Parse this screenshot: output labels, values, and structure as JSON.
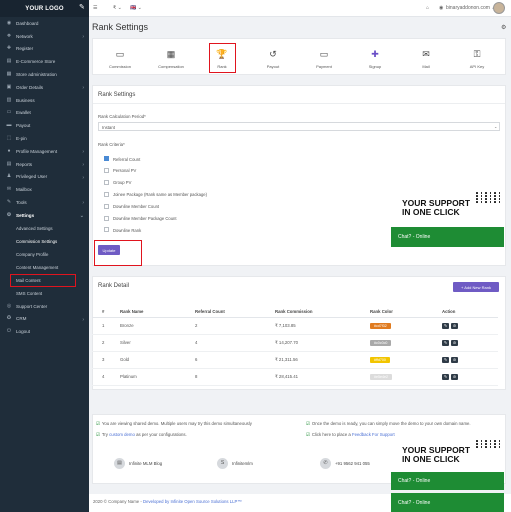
{
  "sidebar": {
    "logo": "YOUR LOGO",
    "items": [
      {
        "label": "Dashboard",
        "icon": "dashboard-icon",
        "glyph": "◉",
        "chev": ""
      },
      {
        "label": "Network",
        "icon": "network-icon",
        "glyph": "❖",
        "chev": "›"
      },
      {
        "label": "Register",
        "icon": "register-icon",
        "glyph": "✚",
        "chev": ""
      },
      {
        "label": "E-Commerce Store",
        "icon": "store-icon",
        "glyph": "▤",
        "chev": ""
      },
      {
        "label": "Store administration",
        "icon": "store-admin-icon",
        "glyph": "▦",
        "chev": ""
      },
      {
        "label": "Order Details",
        "icon": "order-icon",
        "glyph": "▣",
        "chev": "›"
      },
      {
        "label": "Business",
        "icon": "business-icon",
        "glyph": "▥",
        "chev": ""
      },
      {
        "label": "Ewallet",
        "icon": "wallet-icon",
        "glyph": "▭",
        "chev": ""
      },
      {
        "label": "Payout",
        "icon": "payout-icon",
        "glyph": "▬",
        "chev": ""
      },
      {
        "label": "E-pin",
        "icon": "pin-icon",
        "glyph": "⬚",
        "chev": ""
      },
      {
        "label": "Profile Management",
        "icon": "profile-icon",
        "glyph": "●",
        "chev": "›"
      },
      {
        "label": "Reports",
        "icon": "reports-icon",
        "glyph": "▤",
        "chev": "›"
      },
      {
        "label": "Privileged User",
        "icon": "privileged-user-icon",
        "glyph": "♟",
        "chev": "›"
      },
      {
        "label": "Mailbox",
        "icon": "mailbox-icon",
        "glyph": "✉",
        "chev": ""
      },
      {
        "label": "Tools",
        "icon": "tools-icon",
        "glyph": "✎",
        "chev": "›"
      },
      {
        "label": "Settings",
        "icon": "settings-icon",
        "glyph": "⚙",
        "chev": "⌄"
      }
    ],
    "sub_items": [
      "Advanced Settings",
      "Commission Settings",
      "Company Profile",
      "Content Management",
      "Mail Content",
      "SMS Content"
    ],
    "bottom_items": [
      {
        "label": "Support Center",
        "icon": "support-icon",
        "glyph": "◎",
        "chev": ""
      },
      {
        "label": "CRM",
        "icon": "crm-icon",
        "glyph": "✪",
        "chev": "›"
      },
      {
        "label": "Logout",
        "icon": "logout-icon",
        "glyph": "⏻",
        "chev": ""
      }
    ]
  },
  "topbar": {
    "menu": "☰",
    "currency": "₹ ⌄",
    "flag": "🇬🇧 ⌄",
    "cart": "⌂",
    "bell": "◉",
    "user": "binaryaddonon.com ⌄"
  },
  "page": {
    "title": "Rank Settings"
  },
  "tabs": [
    {
      "label": "Commission",
      "glyph": "▭",
      "purple": false
    },
    {
      "label": "Compensation",
      "glyph": "▦",
      "purple": false
    },
    {
      "label": "Rank",
      "glyph": "🏆",
      "purple": false
    },
    {
      "label": "Payout",
      "glyph": "↺",
      "purple": false
    },
    {
      "label": "Payment",
      "glyph": "▭",
      "purple": false
    },
    {
      "label": "Signup",
      "glyph": "✚",
      "purple": true
    },
    {
      "label": "Mail",
      "glyph": "✉",
      "purple": false
    },
    {
      "label": "API Key",
      "glyph": "⚿",
      "purple": false
    }
  ],
  "rank_settings": {
    "title": "Rank Settings",
    "period_label": "Rank Calculation Period*",
    "period_value": "Instant",
    "criteria_label": "Rank Criteria*",
    "criteria": [
      {
        "label": "Referral Count",
        "checked": true
      },
      {
        "label": "Personal PV",
        "checked": false
      },
      {
        "label": "Group PV",
        "checked": false
      },
      {
        "label": "Joinee Package (Rank same as Member package)",
        "checked": false
      },
      {
        "label": "Downline Member Count",
        "checked": false
      },
      {
        "label": "Downline Member Package Count",
        "checked": false
      },
      {
        "label": "Downline Rank",
        "checked": false
      }
    ],
    "update_label": "Update"
  },
  "support": {
    "line1": "YOUR SUPPORT",
    "line2": "IN ONE CLICK",
    "chat": "Chat? - Online"
  },
  "rank_detail": {
    "title": "Rank Detail",
    "add_label": "+ Add New Rank",
    "headers": [
      "#",
      "Rank Name",
      "Referral Count",
      "Rank Commission",
      "Rank Color",
      "Action"
    ],
    "rows": [
      {
        "n": "1",
        "name": "Bronze",
        "count": "2",
        "commission": "₹ 7,103.85",
        "color_label": "#cd7f32",
        "color": "#e07b1f"
      },
      {
        "n": "2",
        "name": "Silver",
        "count": "4",
        "commission": "₹ 14,207.70",
        "color_label": "#c0c0c0",
        "color": "#a9a9a9"
      },
      {
        "n": "3",
        "name": "Gold",
        "count": "6",
        "commission": "₹ 21,311.56",
        "color_label": "#ffd700",
        "color": "#f2c500"
      },
      {
        "n": "4",
        "name": "Platinum",
        "count": "8",
        "commission": "₹ 28,415.41",
        "color_label": "#e5e4e2",
        "color": "#dcdcdc"
      }
    ]
  },
  "info": {
    "left1": "You are viewing shared demo. Multiple users may try this demo simultaneously",
    "left2_pre": "Try ",
    "left2_link": "custom demo",
    "left2_post": " as per your configurations.",
    "right1": "Once the demo is ready, you can simply move the demo to your own domain name.",
    "right2_pre": "Click here to place a ",
    "right2_link": "Feedback For Support"
  },
  "contacts": [
    {
      "label": "Infinite MLM Blog",
      "icon": "blog-icon",
      "glyph": "▤"
    },
    {
      "label": "Infinitemlm",
      "icon": "skype-icon",
      "glyph": "S"
    },
    {
      "label": "+91 9562 941 055",
      "icon": "whatsapp-icon",
      "glyph": "✆"
    }
  ],
  "support2": {
    "line1": "YOUR SUPPORT",
    "line2": "IN ONE CLICK",
    "chat1": "Chat? - Online",
    "chat2": "Chat? - Online"
  },
  "footer": {
    "pre": "2020 © Company Name - ",
    "link": "Developed by Infinite Open Source Solutions LLP™"
  }
}
